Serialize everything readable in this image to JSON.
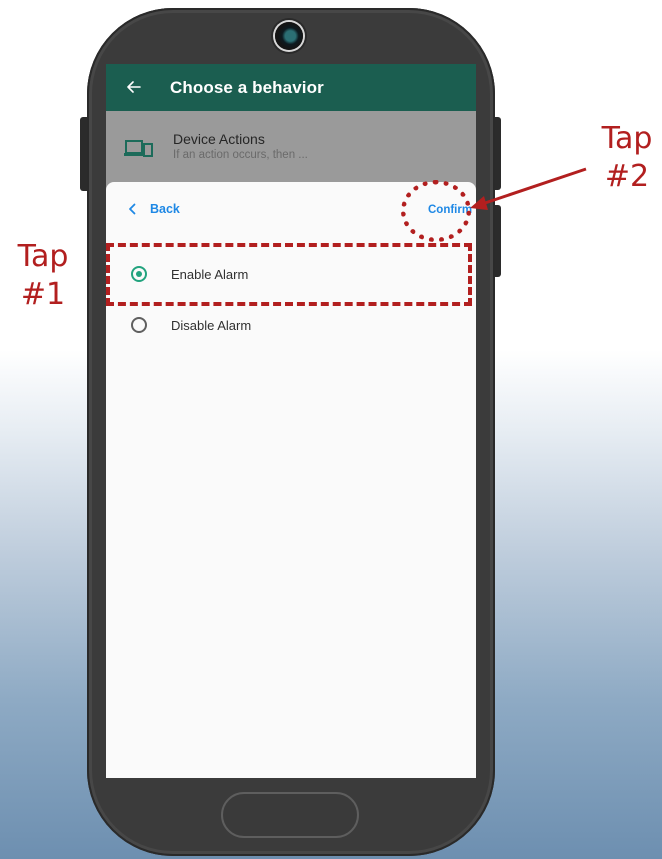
{
  "app_header": {
    "title": "Choose a behavior",
    "back_icon": "arrow-left-icon"
  },
  "background_list": {
    "item": {
      "icon": "devices-icon",
      "title": "Device Actions",
      "subtitle": "If an action occurs, then ..."
    }
  },
  "sheet": {
    "back_label": "Back",
    "confirm_label": "Confirm",
    "options": [
      {
        "label": "Enable Alarm",
        "selected": true
      },
      {
        "label": "Disable Alarm",
        "selected": false
      }
    ]
  },
  "annotations": {
    "tap1": "Tap\n#1",
    "tap2": "Tap\n#2",
    "color": "#b21f1f"
  },
  "colors": {
    "header_bg": "#1b5e50",
    "accent_blue": "#1e88e5",
    "radio_green": "#22a37e"
  }
}
